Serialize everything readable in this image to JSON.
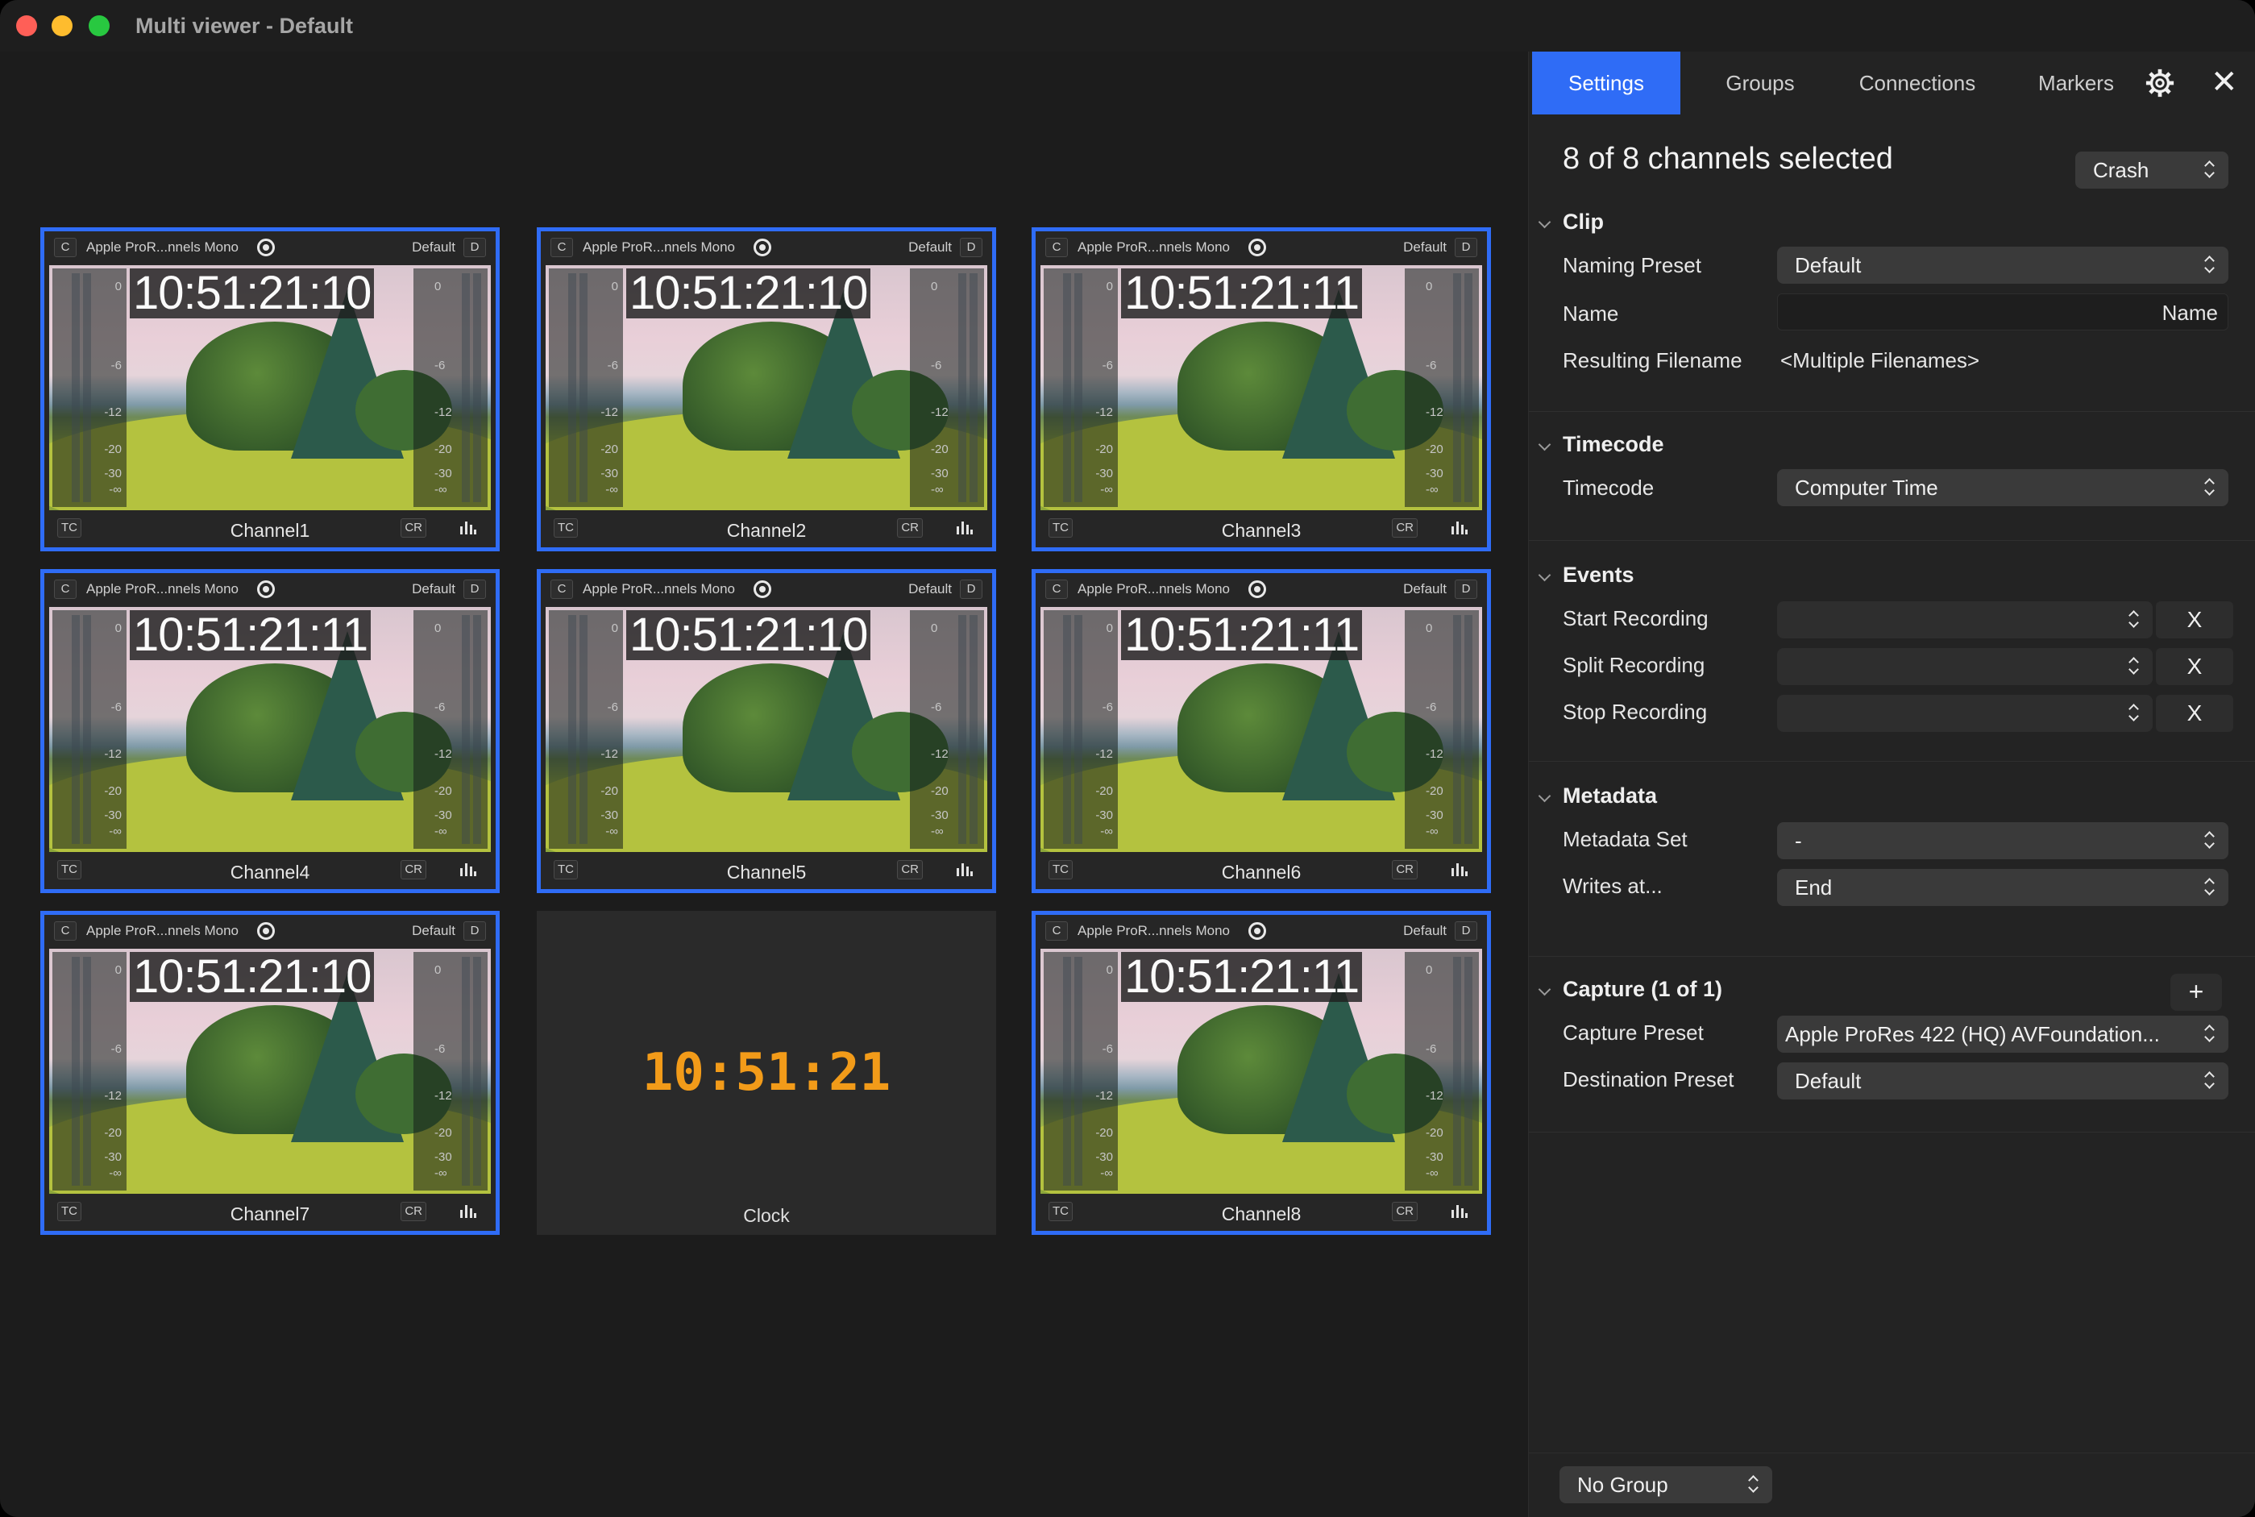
{
  "window": {
    "title": "Multi viewer - Default"
  },
  "tile_common": {
    "c_label": "C",
    "codec": "Apple ProR...nnels Mono",
    "preset": "Default",
    "d_label": "D",
    "tc_label": "TC",
    "cr_label": "CR",
    "meter_ticks": [
      "0",
      "-6",
      "-12",
      "-20",
      "-30",
      "-∞"
    ]
  },
  "channels": [
    {
      "name": "Channel1",
      "timecode": "10:51:21:10"
    },
    {
      "name": "Channel2",
      "timecode": "10:51:21:10"
    },
    {
      "name": "Channel3",
      "timecode": "10:51:21:11"
    },
    {
      "name": "Channel4",
      "timecode": "10:51:21:11"
    },
    {
      "name": "Channel5",
      "timecode": "10:51:21:10"
    },
    {
      "name": "Channel6",
      "timecode": "10:51:21:11"
    },
    {
      "name": "Channel7",
      "timecode": "10:51:21:10"
    },
    {
      "name": "Channel8",
      "timecode": "10:51:21:11"
    }
  ],
  "clock": {
    "time": "10:51:21",
    "label": "Clock",
    "color": "#f29b19"
  },
  "panel": {
    "tabs": [
      "Settings",
      "Groups",
      "Connections",
      "Markers"
    ],
    "active_tab": "Settings",
    "accent": "#2f6cf6",
    "selection_title": "8 of 8 channels selected",
    "mode_select": "Crash",
    "clip": {
      "header": "Clip",
      "naming_preset_label": "Naming Preset",
      "naming_preset_value": "Default",
      "name_label": "Name",
      "name_placeholder": "Name",
      "resulting_filename_label": "Resulting Filename",
      "resulting_filename_value": "<Multiple Filenames>"
    },
    "timecode": {
      "header": "Timecode",
      "label": "Timecode",
      "value": "Computer Time"
    },
    "events": {
      "header": "Events",
      "start_label": "Start Recording",
      "split_label": "Split Recording",
      "stop_label": "Stop Recording",
      "clear_label": "X"
    },
    "metadata": {
      "header": "Metadata",
      "set_label": "Metadata Set",
      "set_value": "-",
      "writes_label": "Writes at...",
      "writes_value": "End"
    },
    "capture": {
      "header": "Capture (1 of 1)",
      "add_label": "+",
      "capture_preset_label": "Capture Preset",
      "capture_preset_value": "Apple ProRes 422 (HQ) AVFoundation...",
      "destination_preset_label": "Destination Preset",
      "destination_preset_value": "Default"
    },
    "footer": {
      "group_select": "No Group"
    }
  }
}
